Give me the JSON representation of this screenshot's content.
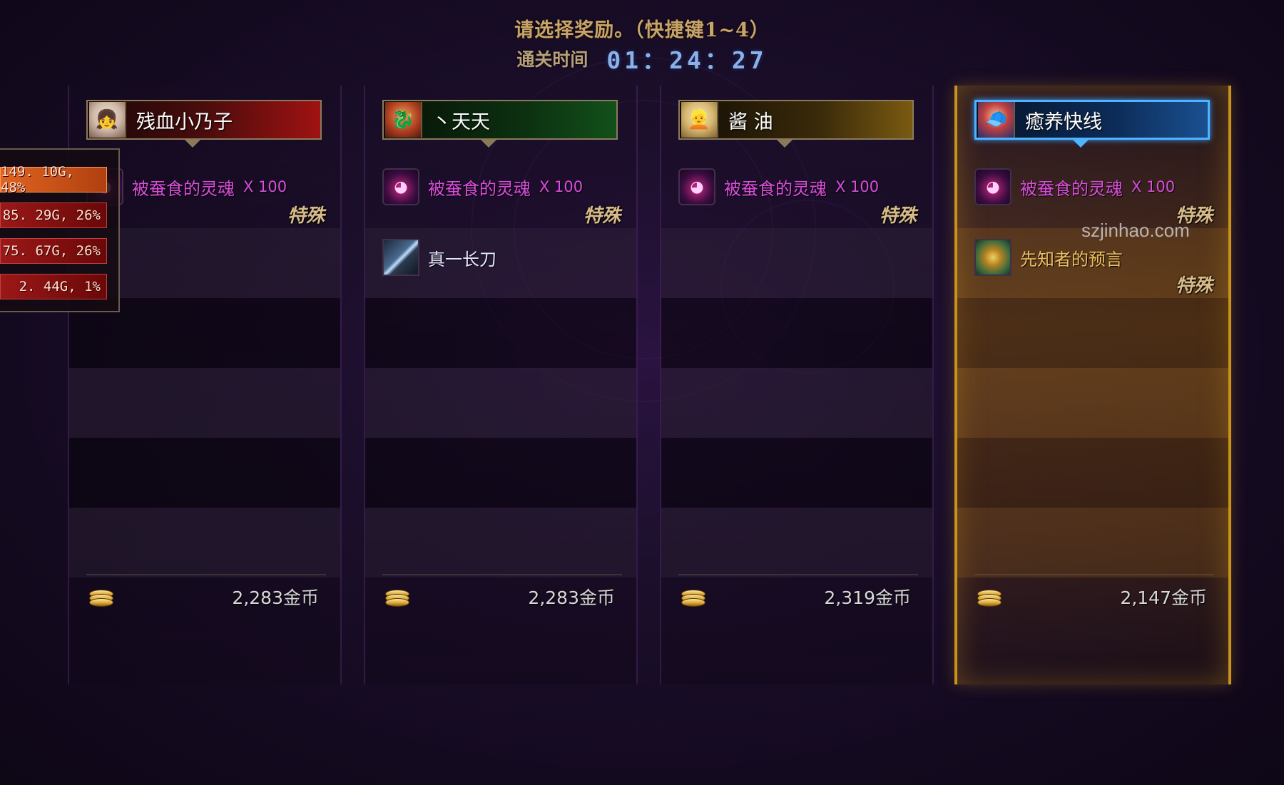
{
  "header": {
    "title": "请选择奖励。（快捷键1~4）",
    "timer_label": "通关时间",
    "timer_value": "01：24：27"
  },
  "damage_meter": [
    {
      "text": "149. 10G, 48%"
    },
    {
      "text": "85. 29G, 26%"
    },
    {
      "text": "75. 67G, 26%"
    },
    {
      "text": "2. 44G, 1%"
    }
  ],
  "columns": [
    {
      "player_name": "残血小乃子",
      "banner_color": "#a01212",
      "avatar_icon": "portrait-female-mage-icon",
      "rewards": [
        {
          "name": "被蚕食的灵魂",
          "qty": "X 100",
          "tag": "特殊",
          "icon": "devoured-soul-icon"
        }
      ],
      "gold": "2,283金币"
    },
    {
      "player_name": "丶天天",
      "banner_color": "#12501a",
      "avatar_icon": "portrait-dragon-warrior-icon",
      "rewards": [
        {
          "name": "被蚕食的灵魂",
          "qty": "X 100",
          "tag": "特殊",
          "icon": "devoured-soul-icon"
        },
        {
          "name": "真一长刀",
          "icon": "long-sword-icon"
        }
      ],
      "gold": "2,283金币"
    },
    {
      "player_name": "酱 油",
      "banner_color": "#7a5a12",
      "avatar_icon": "portrait-priestess-icon",
      "rewards": [
        {
          "name": "被蚕食的灵魂",
          "qty": "X 100",
          "tag": "特殊",
          "icon": "devoured-soul-icon"
        }
      ],
      "gold": "2,319金币"
    },
    {
      "player_name": "癒养快线",
      "banner_color": "#1a5090",
      "avatar_icon": "portrait-gunner-icon",
      "selected": true,
      "rewards": [
        {
          "name": "被蚕食的灵魂",
          "qty": "X 100",
          "tag": "特殊",
          "icon": "devoured-soul-icon"
        },
        {
          "name": "先知者的预言",
          "tag": "特殊",
          "icon": "prophecy-icon"
        }
      ],
      "gold": "2,147金币"
    }
  ],
  "watermark": "szjinhao.com",
  "colors": {
    "title_gold": "#c9a46a",
    "timer_blue": "#8fb0e4",
    "epic_purple": "#d94ed9",
    "selected_glow": "#c8921c"
  }
}
